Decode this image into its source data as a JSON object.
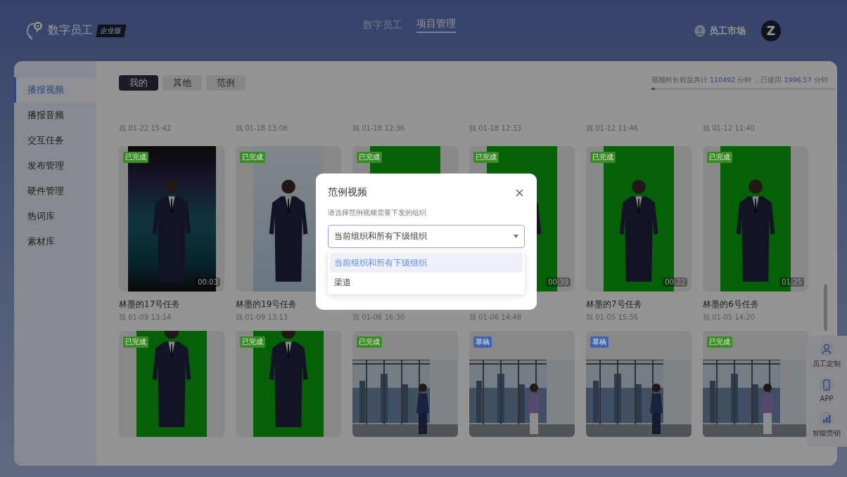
{
  "header": {
    "logo_text": "数字员工",
    "edition_badge": "企业版",
    "nav": [
      {
        "label": "数字员工",
        "selected": false
      },
      {
        "label": "项目管理",
        "selected": true
      }
    ],
    "market_link": "员工市场",
    "avatar_letter": "Z"
  },
  "sidebar": {
    "items": [
      {
        "label": "播报视频",
        "selected": true
      },
      {
        "label": "播报音频",
        "selected": false
      },
      {
        "label": "交互任务",
        "selected": false
      },
      {
        "label": "发布管理",
        "selected": false
      },
      {
        "label": "硬件管理",
        "selected": false
      },
      {
        "label": "热词库",
        "selected": false
      },
      {
        "label": "素材库",
        "selected": false
      }
    ]
  },
  "tabs": [
    {
      "label": "我的",
      "selected": true
    },
    {
      "label": "其他",
      "selected": false
    },
    {
      "label": "范例",
      "selected": false
    }
  ],
  "quota": {
    "segments": [
      {
        "text": "视频时长权益共计",
        "kind": "plain"
      },
      {
        "text": "110492",
        "kind": "number"
      },
      {
        "text": "分钟 ，已使用",
        "kind": "plain"
      },
      {
        "text": "1996.57",
        "kind": "number"
      },
      {
        "text": "分钟",
        "kind": "plain"
      }
    ],
    "level": 0.018
  },
  "previous_row_dates": [
    "我  01-22 15:42",
    "我  01-18 13:06",
    "我  01-18 12:36",
    "我  01-18 12:33",
    "我  01-12 11:46",
    "我  01-12 11:40"
  ],
  "cards": [
    {
      "kind": "poster",
      "status": "已完成",
      "color": "#3d8a2a",
      "duration": "00:03",
      "title": "林墨的17号任务",
      "date": "我  01-09 13:14"
    },
    {
      "kind": "studio",
      "status": "已完成",
      "color": "#3d8a2a",
      "title": "林墨的19号任务",
      "date": "我  01-09 13:13"
    },
    {
      "kind": "green",
      "status": "已完成",
      "color": "#3d8a2a",
      "date": "我  01-06 16:30"
    },
    {
      "kind": "green",
      "status": "已完成",
      "color": "#3d8a2a",
      "duration": "00:39",
      "date": "我  01-06 14:48"
    },
    {
      "kind": "green",
      "status": "已完成",
      "color": "#3d8a2a",
      "duration": "00:22",
      "title": "林墨的7号任务",
      "date": "我  01-05 15:56"
    },
    {
      "kind": "green",
      "status": "已完成",
      "color": "#3d8a2a",
      "duration": "01:25",
      "title": "林墨的6号任务",
      "date": "我  01-05 14:20"
    },
    {
      "kind": "green",
      "status": "已完成",
      "color": "#3d8a2a"
    },
    {
      "kind": "green",
      "status": "已完成",
      "color": "#3d8a2a"
    },
    {
      "kind": "office",
      "status": "已完成",
      "color": "#3d8a2a"
    },
    {
      "kind": "office",
      "status": "草稿",
      "color": "#3f63b0"
    },
    {
      "kind": "office",
      "status": "草稿",
      "color": "#3f63b0"
    },
    {
      "kind": "office",
      "status": "已完成",
      "color": "#3d8a2a"
    }
  ],
  "float_bar": {
    "items": [
      {
        "kind": "person",
        "label": "员工定制"
      },
      {
        "kind": "phone",
        "label": "APP"
      },
      {
        "kind": "chart",
        "label": "智能营销"
      }
    ]
  },
  "modal": {
    "title": "范例视频",
    "hint": "请选择范例视频需要下发的组织",
    "select": {
      "value": "当前组织和所有下级组织"
    },
    "options": [
      {
        "label": "当前组织和所有下级组织",
        "selected": true
      },
      {
        "label": "渠道",
        "selected": false
      }
    ]
  }
}
